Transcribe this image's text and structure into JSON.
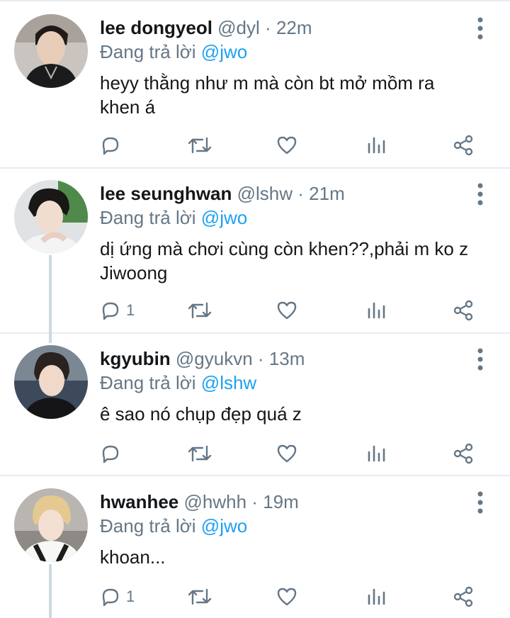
{
  "colors": {
    "name": "#14171a",
    "muted": "#657786",
    "mention": "#1da1f2",
    "divider": "#e6ecf0"
  },
  "icons": [
    "reply-icon",
    "retweet-icon",
    "like-icon",
    "analytics-icon",
    "share-icon",
    "more-icon"
  ],
  "tweets": [
    {
      "name": "lee dongyeol",
      "handle": "@dyl",
      "dot": "·",
      "time": "22m",
      "reply_prefix": "Đang trả lời",
      "reply_to": "@jwo",
      "line1": "heyy thằng như m mà còn bt mở mồm ra",
      "line2": "khen á",
      "reply_count": ""
    },
    {
      "name": "lee seunghwan",
      "handle": "@lshw",
      "dot": "·",
      "time": "21m",
      "reply_prefix": "Đang trả lời",
      "reply_to": "@jwo",
      "line1": "dị ứng mà chơi cùng còn khen??,phải m ko z",
      "line2": "Jiwoong",
      "reply_count": "1"
    },
    {
      "name": "kgyubin",
      "handle": "@gyukvn",
      "dot": "·",
      "time": "13m",
      "reply_prefix": "Đang trả lời",
      "reply_to": "@lshw",
      "line1": "ê sao nó chụp đẹp quá z",
      "line2": "",
      "reply_count": ""
    },
    {
      "name": "hwanhee",
      "handle": "@hwhh",
      "dot": "·",
      "time": "19m",
      "reply_prefix": "Đang trả lời",
      "reply_to": "@jwo",
      "line1": "khoan...",
      "line2": "",
      "reply_count": "1"
    }
  ]
}
